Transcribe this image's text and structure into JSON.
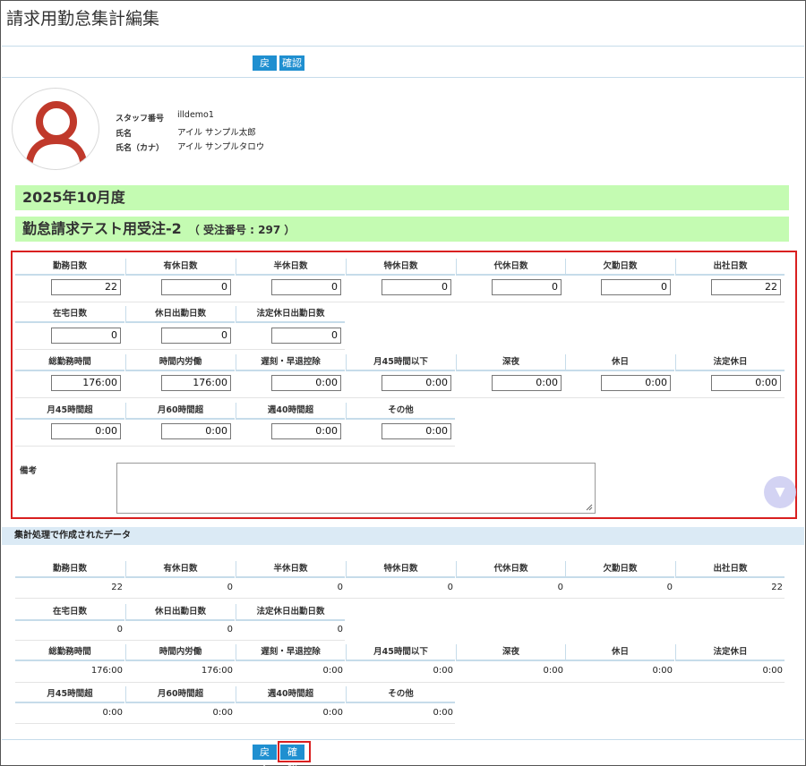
{
  "page": {
    "title": "請求用勤怠集計編集"
  },
  "buttons": {
    "back": "戻る",
    "confirm": "確認"
  },
  "staff": {
    "rows": [
      {
        "label": "スタッフ番号",
        "value": "illdemo1"
      },
      {
        "label": "氏名",
        "value": "アイル サンプル太郎"
      },
      {
        "label": "氏名（カナ）",
        "value": "アイル サンプルタロウ"
      }
    ]
  },
  "period": "2025年10月度",
  "order": {
    "name": "勤怠請求テスト用受注-2",
    "number_label": "（ 受注番号 : 297 ）"
  },
  "edit": {
    "row1": {
      "headers": [
        "勤務日数",
        "有休日数",
        "半休日数",
        "特休日数",
        "代休日数",
        "欠勤日数",
        "出社日数"
      ],
      "values": [
        "22",
        "0",
        "0",
        "0",
        "0",
        "0",
        "22"
      ]
    },
    "row2": {
      "headers": [
        "在宅日数",
        "休日出勤日数",
        "法定休日出勤日数"
      ],
      "values": [
        "0",
        "0",
        "0"
      ]
    },
    "row3": {
      "headers": [
        "総勤務時間",
        "時間内労働",
        "遅刻・早退控除",
        "月45時間以下",
        "深夜",
        "休日",
        "法定休日"
      ],
      "values": [
        "176:00",
        "176:00",
        "0:00",
        "0:00",
        "0:00",
        "0:00",
        "0:00"
      ]
    },
    "row4": {
      "headers": [
        "月45時間超",
        "月60時間超",
        "週40時間超",
        "その他"
      ],
      "values": [
        "0:00",
        "0:00",
        "0:00",
        "0:00"
      ]
    },
    "note_label": "備考",
    "note_value": "",
    "scroll_icon": "▼"
  },
  "aggregated": {
    "title": "集計処理で作成されたデータ",
    "row1": {
      "headers": [
        "勤務日数",
        "有休日数",
        "半休日数",
        "特休日数",
        "代休日数",
        "欠勤日数",
        "出社日数"
      ],
      "values": [
        "22",
        "0",
        "0",
        "0",
        "0",
        "0",
        "22"
      ]
    },
    "row2": {
      "headers": [
        "在宅日数",
        "休日出勤日数",
        "法定休日出勤日数"
      ],
      "values": [
        "0",
        "0",
        "0"
      ]
    },
    "row3": {
      "headers": [
        "総勤務時間",
        "時間内労働",
        "遅刻・早退控除",
        "月45時間以下",
        "深夜",
        "休日",
        "法定休日"
      ],
      "values": [
        "176:00",
        "176:00",
        "0:00",
        "0:00",
        "0:00",
        "0:00",
        "0:00"
      ]
    },
    "row4": {
      "headers": [
        "月45時間超",
        "月60時間超",
        "週40時間超",
        "その他"
      ],
      "values": [
        "0:00",
        "0:00",
        "0:00",
        "0:00"
      ]
    }
  },
  "icons": {
    "avatar": "user-silhouette-icon",
    "scroll": "scroll-down-icon",
    "resize": "resize-grip-icon"
  },
  "colors": {
    "button": "#1f8fd0",
    "highlight": "#d92020",
    "green_bar": "#c4fbb2",
    "section": "#dbeaf5",
    "avatar": "#c0392b"
  }
}
